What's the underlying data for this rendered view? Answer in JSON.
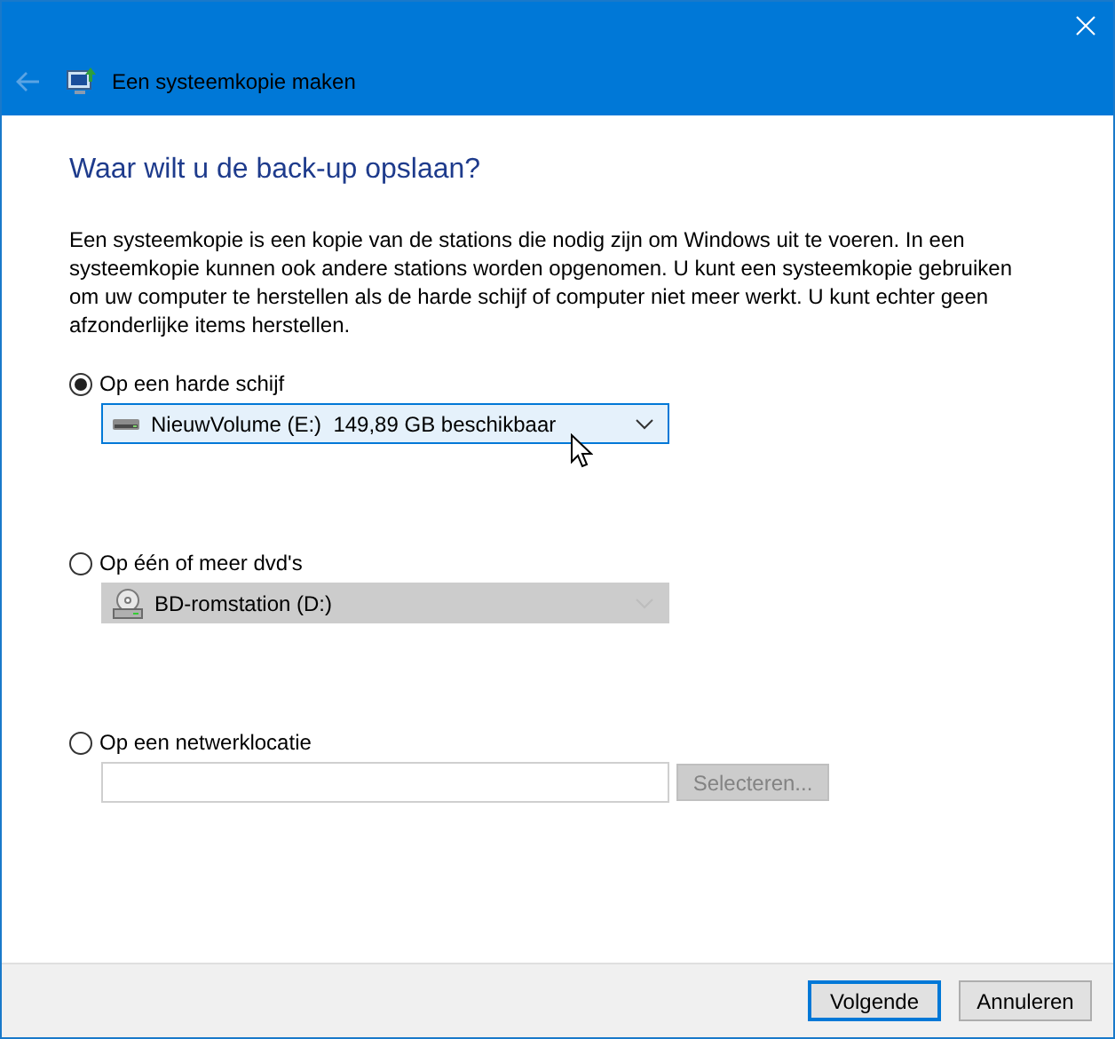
{
  "window": {
    "title": "Een systeemkopie maken",
    "back_disabled": true
  },
  "heading": "Waar wilt u de back-up opslaan?",
  "description": "Een systeemkopie is een kopie van de stations die nodig zijn om Windows uit te voeren. In een systeemkopie kunnen ook andere stations worden opgenomen. U kunt een systeemkopie gebruiken om uw computer te herstellen als de harde schijf of computer niet meer werkt. U kunt echter geen afzonderlijke items herstellen.",
  "options": [
    {
      "label": "Op een harde schijf",
      "selected": true,
      "kind": "dropdown",
      "value": "NieuwVolume (E:)  149,89 GB beschikbaar",
      "optical": false,
      "disabled": false,
      "hovered": true
    },
    {
      "label": "Op één of meer dvd's",
      "selected": false,
      "kind": "dropdown",
      "value": "BD-romstation (D:)",
      "optical": true,
      "disabled": true,
      "hovered": false
    },
    {
      "label": "Op een netwerklocatie",
      "selected": false,
      "kind": "path",
      "button": "Selecteren...",
      "disabled": true
    }
  ],
  "buttons": [
    {
      "label": "Volgende",
      "default": true
    },
    {
      "label": "Annuleren",
      "default": false
    }
  ]
}
